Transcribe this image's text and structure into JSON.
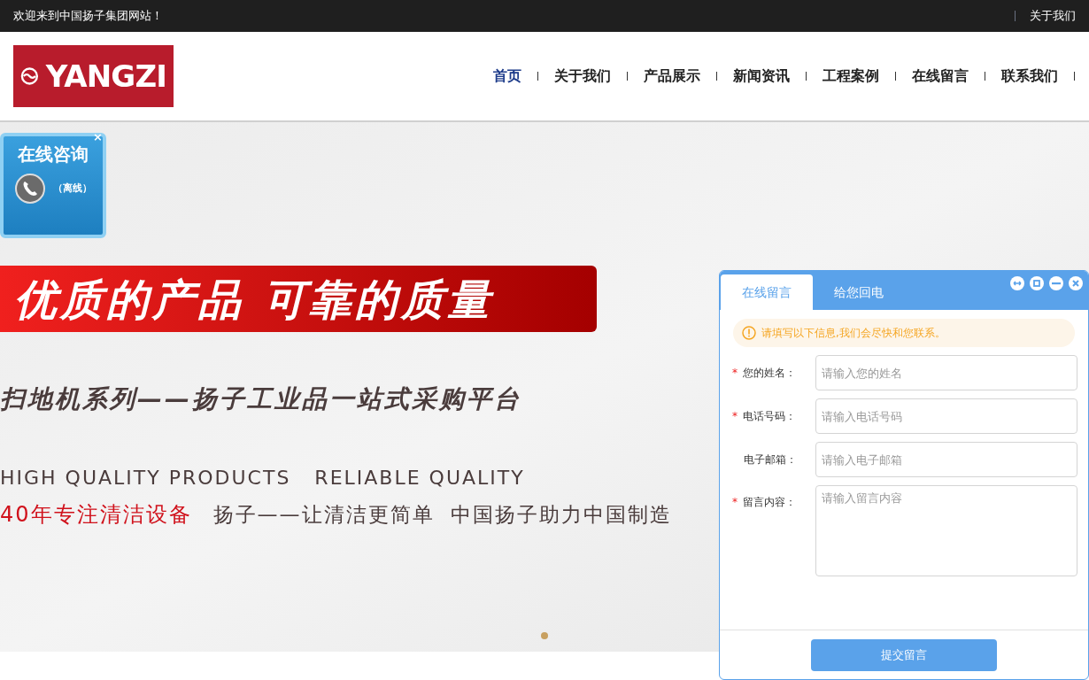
{
  "top_bar": {
    "welcome": "欢迎来到中国扬子集团网站！",
    "links": [
      "关于我们"
    ]
  },
  "header": {
    "logo_text": "YANGZI",
    "nav": [
      {
        "label": "首页",
        "selected": true
      },
      {
        "label": "关于我们",
        "selected": false
      },
      {
        "label": "产品展示",
        "selected": false
      },
      {
        "label": "新闻资讯",
        "selected": false
      },
      {
        "label": "工程案例",
        "selected": false
      },
      {
        "label": "在线留言",
        "selected": false
      },
      {
        "label": "联系我们",
        "selected": false
      }
    ]
  },
  "consult_widget": {
    "title": "在线咨询",
    "status": "（离线）",
    "close": "×"
  },
  "banner": {
    "headline": "优质的产品 可靠的质量",
    "subtitle": "扫地机系列——扬子工业品一站式采购平台",
    "english": "HIGH QUALITY PRODUCTS   RELIABLE QUALITY",
    "highlight": "40年专注清洁设备",
    "slogan": "扬子——让清洁更简单  中国扬子助力中国制造",
    "dots": [
      {
        "selected": true
      }
    ]
  },
  "message_panel": {
    "tabs": [
      {
        "label": "在线留言",
        "selected": true
      },
      {
        "label": "给您回电",
        "selected": false
      }
    ],
    "notice": "请填写以下信息,我们会尽快和您联系。",
    "fields": [
      {
        "kind": "input",
        "label": "您的姓名：",
        "required": true,
        "placeholder": "请输入您的姓名"
      },
      {
        "kind": "input",
        "label": "电话号码：",
        "required": true,
        "placeholder": "请输入电话号码"
      },
      {
        "kind": "input",
        "label": "电子邮箱：",
        "required": false,
        "placeholder": "请输入电子邮箱"
      },
      {
        "kind": "textarea",
        "label": "留言内容：",
        "required": true,
        "placeholder": "请输入留言内容"
      }
    ],
    "required_mark": "*",
    "submit": "提交留言"
  }
}
